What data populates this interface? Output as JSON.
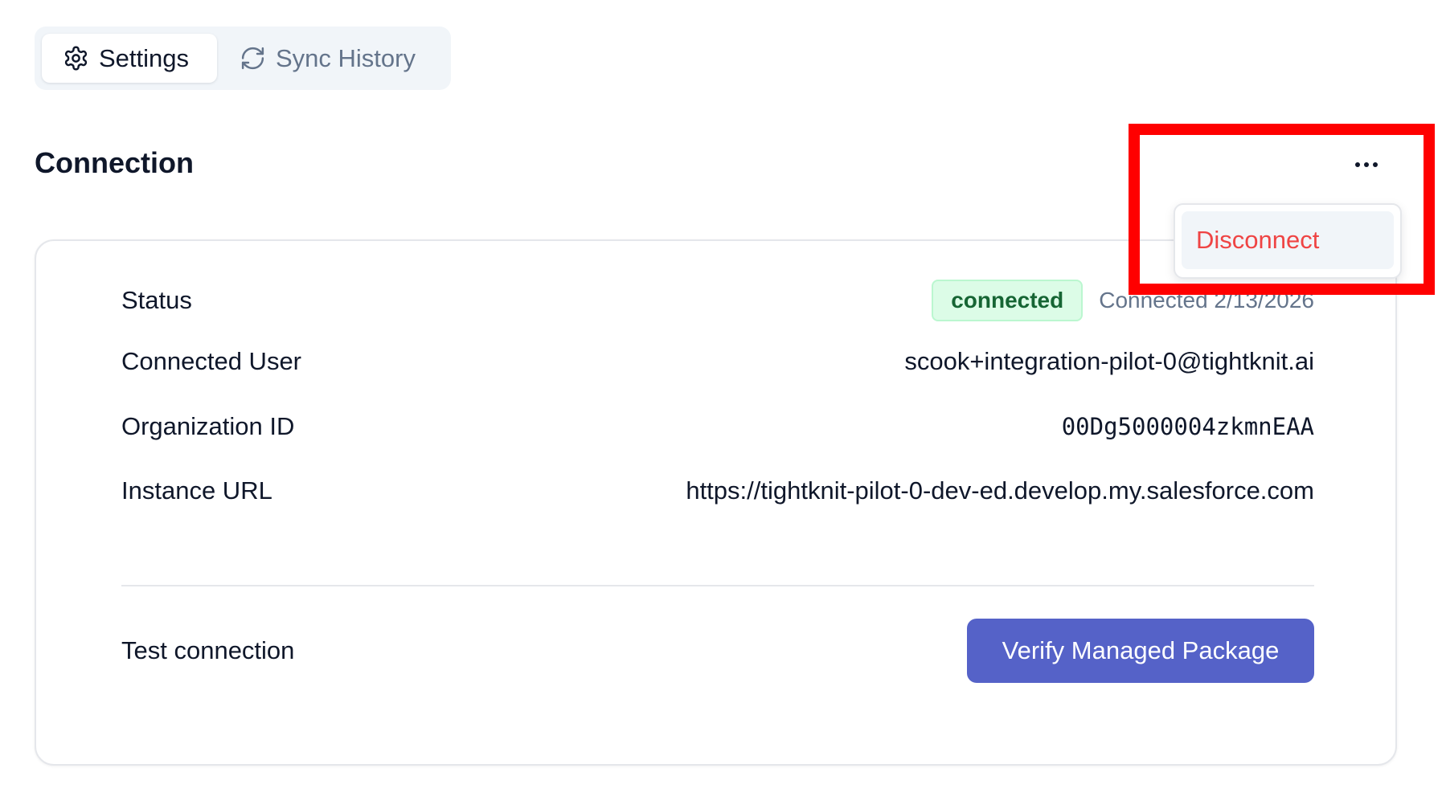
{
  "tabs": [
    {
      "label": "Settings",
      "icon": "gear-icon",
      "active": true
    },
    {
      "label": "Sync History",
      "icon": "refresh-icon",
      "active": false
    }
  ],
  "section": {
    "title": "Connection",
    "more_icon": "ellipsis-icon"
  },
  "menu": {
    "items": [
      {
        "label": "Disconnect",
        "color": "#ef4444"
      }
    ]
  },
  "details": {
    "status_label": "Status",
    "status_badge": "connected",
    "status_date": "Connected 2/13/2026",
    "user_label": "Connected User",
    "user_value": "scook+integration-pilot-0@tightknit.ai",
    "org_label": "Organization ID",
    "org_value": "00Dg5000004zkmnEAA",
    "url_label": "Instance URL",
    "url_value": "https://tightknit-pilot-0-dev-ed.develop.my.salesforce.com"
  },
  "test": {
    "label": "Test connection",
    "button_label": "Verify Managed Package"
  },
  "colors": {
    "accent": "#5562c8",
    "success_bg": "#dcfce7",
    "success_text": "#166534",
    "danger": "#ef4444",
    "highlight": "#ff0000"
  }
}
